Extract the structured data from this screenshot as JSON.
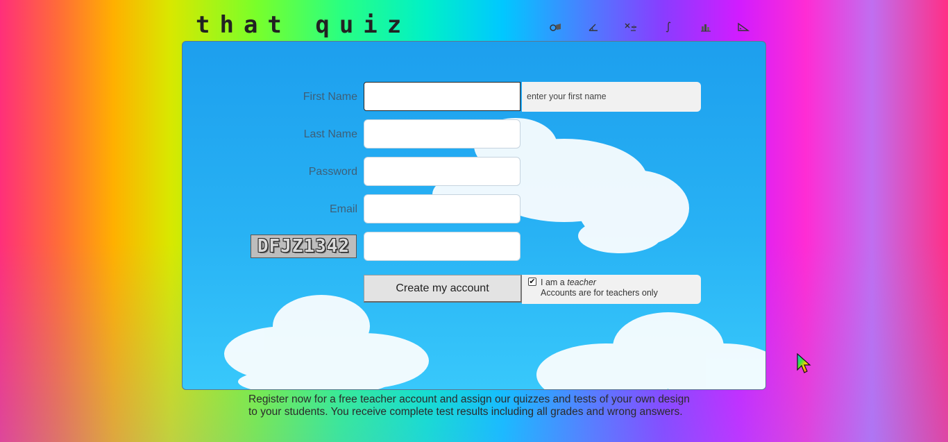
{
  "logo": {
    "text": "that quiz"
  },
  "top_icons": [
    {
      "name": "fractions-icon"
    },
    {
      "name": "geometry-angle-icon"
    },
    {
      "name": "arithmetic-icon"
    },
    {
      "name": "integral-icon"
    },
    {
      "name": "graph-icon"
    },
    {
      "name": "triangle-ruler-icon"
    }
  ],
  "form": {
    "first_name": {
      "label": "First Name",
      "value": "",
      "hint": "enter your first name"
    },
    "last_name": {
      "label": "Last Name",
      "value": ""
    },
    "password": {
      "label": "Password",
      "value": ""
    },
    "email": {
      "label": "Email",
      "value": ""
    },
    "captcha": {
      "image_text": "DFJZ1342",
      "value": ""
    },
    "submit_label": "Create my account",
    "teacher": {
      "checked": true,
      "prefix": "I am a",
      "emphasis": "teacher",
      "note": "Accounts are for teachers only"
    }
  },
  "footer_text": "Register now for a free teacher account and assign our quizzes and tests of your own design to your students. You receive complete test results including all grades and wrong answers.",
  "colors": {
    "panel_sky": "#28b2f4",
    "label_text": "#3e5f78",
    "hint_bg": "#f1f1f1"
  }
}
